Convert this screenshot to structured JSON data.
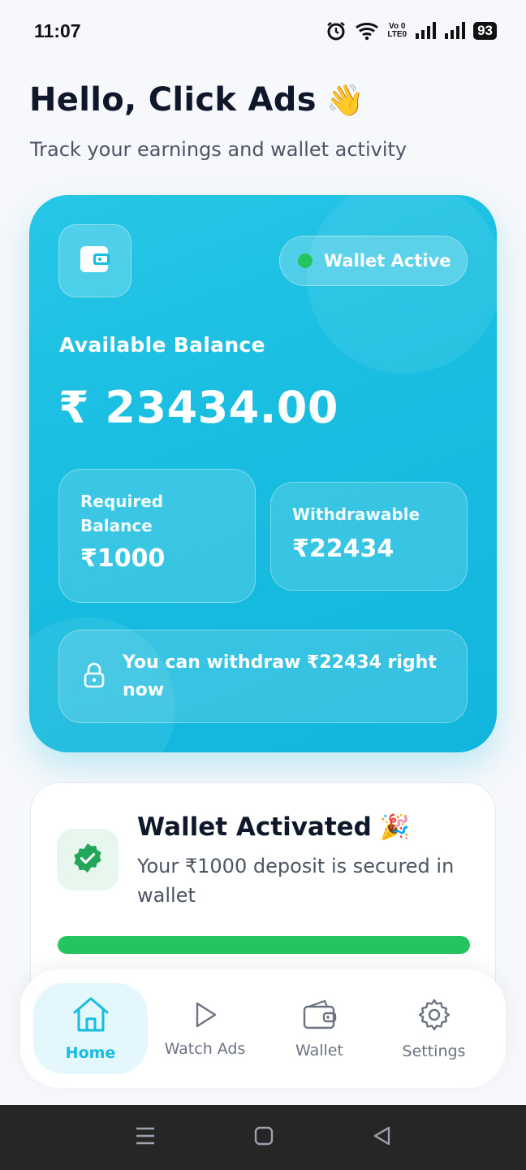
{
  "status_bar": {
    "time": "11:07",
    "volte_top": "Vo 0",
    "volte_bottom": "LTE0",
    "battery": "93"
  },
  "header": {
    "greeting": "Hello, Click Ads",
    "greeting_emoji": "👋",
    "subtitle": "Track your earnings and wallet activity"
  },
  "balance_card": {
    "status_label": "Wallet Active",
    "available_label": "Available Balance",
    "available_value": "₹ 23434.00",
    "required_label": "Required Balance",
    "required_value": "₹1000",
    "withdrawable_label": "Withdrawable",
    "withdrawable_value": "₹22434",
    "notice": "You can withdraw ₹22434 right now",
    "colors": {
      "card": "#18bde0",
      "status_dot": "#22c55e"
    }
  },
  "activation": {
    "title": "Wallet Activated",
    "title_emoji": "🎉",
    "description": "Your ₹1000 deposit is secured in wallet",
    "progress": 1.0,
    "progress_color": "#22c55e"
  },
  "bottom_nav": {
    "items": [
      {
        "label": "Home",
        "icon": "home-icon",
        "active": true
      },
      {
        "label": "Watch Ads",
        "icon": "play-icon",
        "active": false
      },
      {
        "label": "Wallet",
        "icon": "wallet-icon",
        "active": false
      },
      {
        "label": "Settings",
        "icon": "gear-icon",
        "active": false
      }
    ],
    "active_color": "#17bde0"
  },
  "system_nav": {
    "icons": [
      "menu-icon",
      "home-square-icon",
      "back-icon"
    ]
  }
}
